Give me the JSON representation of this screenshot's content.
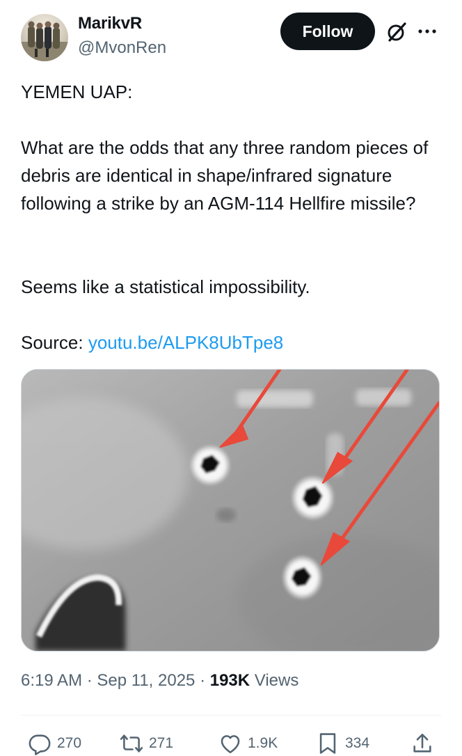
{
  "author": {
    "display_name": "MarikvR",
    "handle": "@MvonRen",
    "avatar_icon": "avatar-group-photo"
  },
  "header": {
    "follow_label": "Follow",
    "grok_icon": "grok-icon",
    "more_icon": "more-icon"
  },
  "post": {
    "line1": "YEMEN UAP:",
    "paragraph2": "What are the odds that any three random pieces of debris are identical in shape/infrared signature following a strike by an AGM-114 Hellfire missile?",
    "paragraph3": "Seems like a statistical impossibility.",
    "source_label": "Source: ",
    "source_link": "youtu.be/ALPK8UbTpe8"
  },
  "media": {
    "description_icon": "infrared-drone-footage",
    "arrow_color": "#e8493a"
  },
  "meta": {
    "time": "6:19 AM",
    "sep1": " · ",
    "date": "Sep 11, 2025",
    "sep2": " · ",
    "views_count": "193K",
    "views_label": " Views"
  },
  "actions": {
    "replies": "270",
    "reposts": "271",
    "likes": "1.9K",
    "bookmarks": "334"
  },
  "colors": {
    "link": "#1d9bf0",
    "secondary_text": "#536471",
    "primary_text": "#0f1419"
  }
}
